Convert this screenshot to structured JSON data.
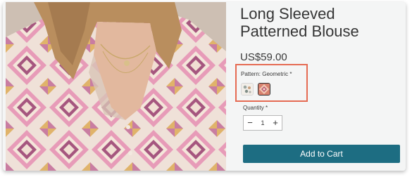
{
  "product": {
    "title": "Long Sleeved Patterned Blouse",
    "price": "US$59.00"
  },
  "pattern": {
    "label": "Pattern: Geometric *",
    "selected": "Geometric",
    "options": [
      "Floral",
      "Geometric"
    ]
  },
  "quantity": {
    "label": "Quantity *",
    "value": "1",
    "minus_symbol": "−",
    "plus_symbol": "+"
  },
  "cart": {
    "button_label": "Add to Cart"
  },
  "colors": {
    "accent_button": "#1d6d82",
    "highlight_border": "#e56b53",
    "title_text": "#353535"
  }
}
